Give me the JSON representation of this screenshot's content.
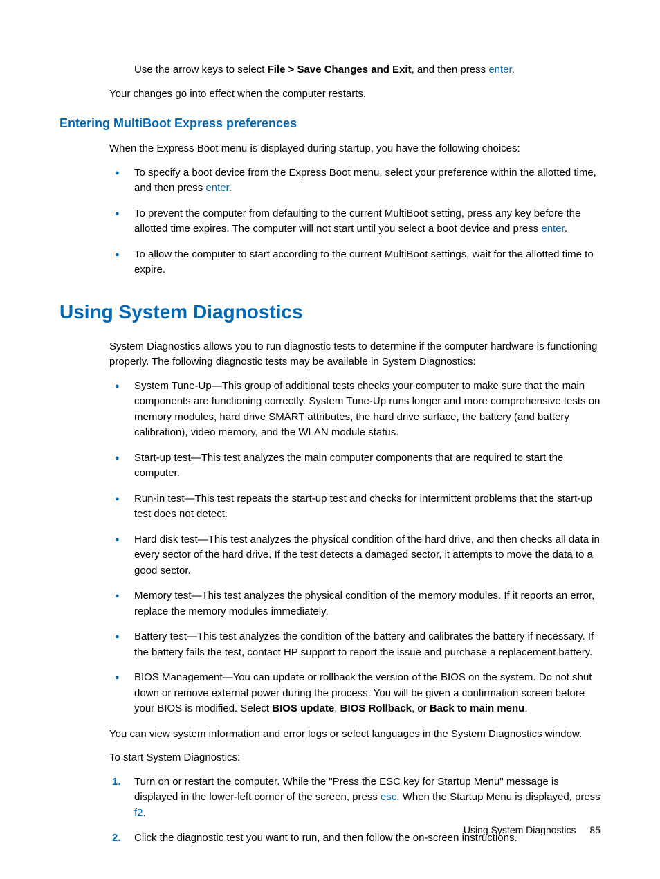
{
  "intro": {
    "line1_pre": "Use the arrow keys to select ",
    "line1_bold": "File > Save Changes and Exit",
    "line1_mid": ", and then press ",
    "line1_key": "enter",
    "line1_post": ".",
    "line2": "Your changes go into effect when the computer restarts."
  },
  "section1": {
    "heading": "Entering MultiBoot Express preferences",
    "intro": "When the Express Boot menu is displayed during startup, you have the following choices:",
    "bullets": [
      {
        "pre": "To specify a boot device from the Express Boot menu, select your preference within the allotted time, and then press ",
        "key": "enter",
        "post": "."
      },
      {
        "pre": "To prevent the computer from defaulting to the current MultiBoot setting, press any key before the allotted time expires. The computer will not start until you select a boot device and press ",
        "key": "enter",
        "post": "."
      },
      {
        "text": "To allow the computer to start according to the current MultiBoot settings, wait for the allotted time to expire."
      }
    ]
  },
  "section2": {
    "heading": "Using System Diagnostics",
    "intro": "System Diagnostics allows you to run diagnostic tests to determine if the computer hardware is functioning properly. The following diagnostic tests may be available in System Diagnostics:",
    "bullets": [
      "System Tune-Up—This group of additional tests checks your computer to make sure that the main components are functioning correctly. System Tune-Up runs longer and more comprehensive tests on memory modules, hard drive SMART attributes, the hard drive surface, the battery (and battery calibration), video memory, and the WLAN module status.",
      "Start-up test—This test analyzes the main computer components that are required to start the computer.",
      "Run-in test—This test repeats the start-up test and checks for intermittent problems that the start-up test does not detect.",
      "Hard disk test—This test analyzes the physical condition of the hard drive, and then checks all data in every sector of the hard drive. If the test detects a damaged sector, it attempts to move the data to a good sector.",
      "Memory test—This test analyzes the physical condition of the memory modules. If it reports an error, replace the memory modules immediately.",
      "Battery test—This test analyzes the condition of the battery and calibrates the battery if necessary. If the battery fails the test, contact HP support to report the issue and purchase a replacement battery."
    ],
    "bios_pre": "BIOS Management—You can update or rollback the version of the BIOS on the system. Do not shut down or remove external power during the process. You will be given a confirmation screen before your BIOS is modified. Select ",
    "bios_b1": "BIOS update",
    "bios_sep1": ", ",
    "bios_b2": "BIOS Rollback",
    "bios_sep2": ", or ",
    "bios_b3": "Back to main menu",
    "bios_post": ".",
    "para2": "You can view system information and error logs or select languages in the System Diagnostics window.",
    "para3": "To start System Diagnostics:",
    "steps": [
      {
        "pre": "Turn on or restart the computer. While the \"Press the ESC key for Startup Menu\" message is displayed in the lower-left corner of the screen, press ",
        "key1": "esc",
        "mid": ". When the Startup Menu is displayed, press ",
        "key2": "f2",
        "post": "."
      },
      {
        "text": "Click the diagnostic test you want to run, and then follow the on-screen instructions."
      }
    ]
  },
  "footer": {
    "title": "Using System Diagnostics",
    "page": "85"
  }
}
